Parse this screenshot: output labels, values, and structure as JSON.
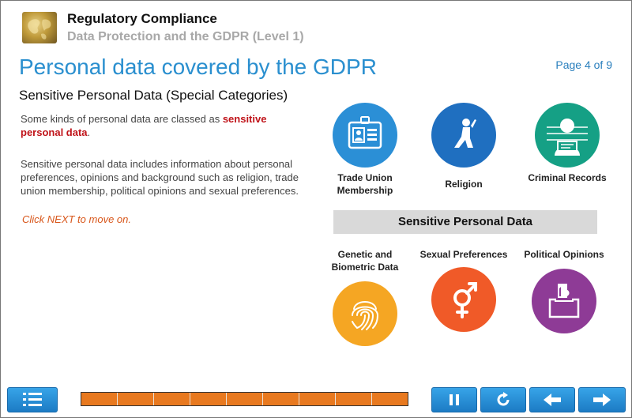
{
  "header": {
    "app_title": "Regulatory Compliance",
    "course_title": "Data Protection and the GDPR (Level 1)"
  },
  "page": {
    "title": "Personal data covered by the GDPR",
    "indicator": "Page 4 of 9",
    "section_heading": "Sensitive Personal Data (Special Categories)",
    "para1_prefix": "Some kinds of personal data are classed as ",
    "para1_highlight": "sensitive personal data",
    "para1_suffix": ".",
    "para2": "Sensitive personal data includes information about personal preferences, opinions and background such as religion, trade union membership, political opinions and sexual preferences.",
    "hint": "Click NEXT to move on."
  },
  "categories": {
    "trade_union": {
      "label": "Trade Union Membership",
      "icon": "id-badge-icon",
      "color": "#2b8fd6"
    },
    "religion": {
      "label": "Religion",
      "icon": "praying-person-icon",
      "color": "#1f6fc0"
    },
    "criminal": {
      "label": "Criminal Records",
      "icon": "prisoner-icon",
      "color": "#15a085"
    },
    "genetic": {
      "label": "Genetic and Biometric Data",
      "icon": "fingerprint-icon",
      "color": "#f5a623"
    },
    "sexual": {
      "label": "Sexual Preferences",
      "icon": "gender-symbol-icon",
      "color": "#f05a28"
    },
    "political": {
      "label": "Political Opinions",
      "icon": "ballot-box-icon",
      "color": "#8e3b96"
    }
  },
  "banner": {
    "label": "Sensitive Personal Data"
  },
  "footer": {
    "menu_icon": "menu-list-icon",
    "pause_icon": "pause-icon",
    "replay_icon": "replay-icon",
    "back_icon": "arrow-left-icon",
    "next_icon": "arrow-right-icon",
    "progress_segments_total": 9,
    "progress_segments_filled": 9
  }
}
